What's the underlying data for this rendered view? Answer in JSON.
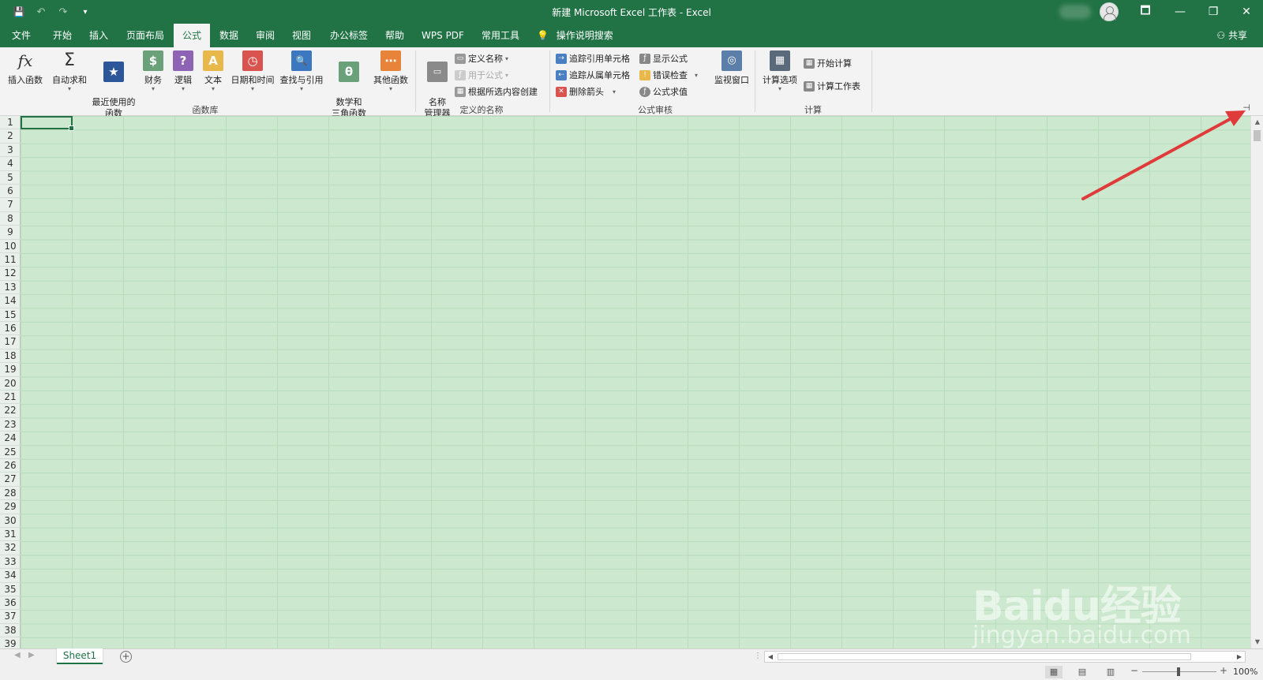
{
  "window": {
    "title": "新建 Microsoft Excel 工作表  -  Excel",
    "controls": {
      "ribbon_display": "🗖",
      "minimize": "—",
      "restore": "❐",
      "close": "✕"
    }
  },
  "quick_access": {
    "save": "💾",
    "undo": "↶",
    "redo": "↷",
    "customize": "▾"
  },
  "tabs": [
    {
      "label": "文件"
    },
    {
      "label": "开始"
    },
    {
      "label": "插入"
    },
    {
      "label": "页面布局"
    },
    {
      "label": "公式"
    },
    {
      "label": "数据"
    },
    {
      "label": "审阅"
    },
    {
      "label": "视图"
    },
    {
      "label": "办公标签"
    },
    {
      "label": "帮助"
    },
    {
      "label": "WPS PDF"
    },
    {
      "label": "常用工具"
    }
  ],
  "active_tab": "公式",
  "tell_me": {
    "icon": "💡",
    "label": "操作说明搜索"
  },
  "share": {
    "label": "共享"
  },
  "ribbon": {
    "function_library": {
      "label": "函数库",
      "buttons": [
        {
          "label": "插入函数",
          "icon": "fx",
          "color": "#ffffff"
        },
        {
          "label": "自动求和",
          "icon": "Σ",
          "color": "#ffffff"
        },
        {
          "label": "最近使用的\n函数",
          "icon": "★",
          "color": "#2b579a"
        },
        {
          "label": "财务",
          "icon": "$",
          "color": "#6aa17a"
        },
        {
          "label": "逻辑",
          "icon": "?",
          "color": "#8e63b5"
        },
        {
          "label": "文本",
          "icon": "A",
          "color": "#e8b84a"
        },
        {
          "label": "日期和时间",
          "icon": "◷",
          "color": "#d9534f"
        },
        {
          "label": "查找与引用",
          "icon": "🔍",
          "color": "#3c78c0"
        },
        {
          "label": "数学和\n三角函数",
          "icon": "θ",
          "color": "#6aa17a"
        },
        {
          "label": "其他函数",
          "icon": "⋯",
          "color": "#e8843a"
        }
      ]
    },
    "defined_names": {
      "label": "定义的名称",
      "name_manager": "名称\n管理器",
      "define_name": "定义名称",
      "use_in_formula": "用于公式",
      "create_from_selection": "根据所选内容创建"
    },
    "formula_auditing": {
      "label": "公式审核",
      "trace_precedents": "追踪引用单元格",
      "trace_dependents": "追踪从属单元格",
      "remove_arrows": "删除箭头",
      "show_formulas": "显示公式",
      "error_checking": "错误检查",
      "evaluate_formula": "公式求值",
      "watch_window": "监视窗口"
    },
    "calculation": {
      "label": "计算",
      "calc_options": "计算选项",
      "calc_now": "开始计算",
      "calc_sheet": "计算工作表"
    },
    "pin_icon": "⊣"
  },
  "rows": [
    "1",
    "2",
    "3",
    "4",
    "5",
    "6",
    "7",
    "8",
    "9",
    "10",
    "11",
    "12",
    "13",
    "14",
    "15",
    "16",
    "17",
    "18",
    "19",
    "20",
    "21",
    "22",
    "23",
    "24",
    "25",
    "26",
    "27",
    "28",
    "29",
    "30",
    "31",
    "32",
    "33",
    "34",
    "35",
    "36",
    "37",
    "38",
    "39"
  ],
  "grid": {
    "background_color": "#cce8cf",
    "accent": "#217346"
  },
  "sheets": [
    {
      "name": "Sheet1",
      "active": true
    }
  ],
  "add_sheet": "+",
  "status": {
    "zoom": "100%",
    "zoom_minus": "−",
    "zoom_plus": "+"
  },
  "watermark": {
    "brand": "Baidu经验",
    "url": "jingyan.baidu.com"
  }
}
